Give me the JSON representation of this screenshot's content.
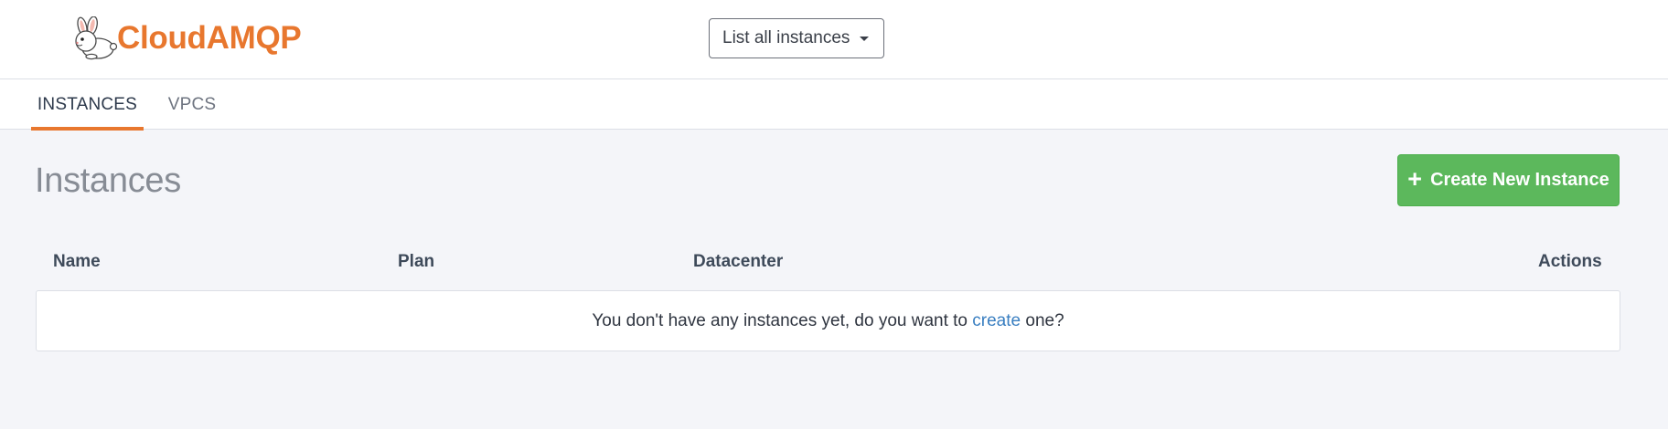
{
  "brand": {
    "name": "CloudAMQP",
    "logo_icon": "rabbit-icon",
    "color": "#e8772e"
  },
  "header": {
    "instance_select": {
      "label": "List all instances",
      "icon": "caret-down-icon"
    }
  },
  "tabs": [
    {
      "label": "INSTANCES",
      "active": true
    },
    {
      "label": "VPCS",
      "active": false
    }
  ],
  "main": {
    "title": "Instances",
    "create_button": {
      "icon": "plus-icon",
      "icon_glyph": "+",
      "label": "Create New Instance",
      "color": "#5cb85c"
    },
    "table": {
      "columns": [
        "Name",
        "Plan",
        "Datacenter",
        "Actions"
      ],
      "empty_message": {
        "before": "You don't have any instances yet, do you want to ",
        "link": "create",
        "after": " one?"
      }
    }
  },
  "colors": {
    "accent": "#e8772e",
    "link": "#3a7fc1",
    "background": "#f4f5f9"
  }
}
